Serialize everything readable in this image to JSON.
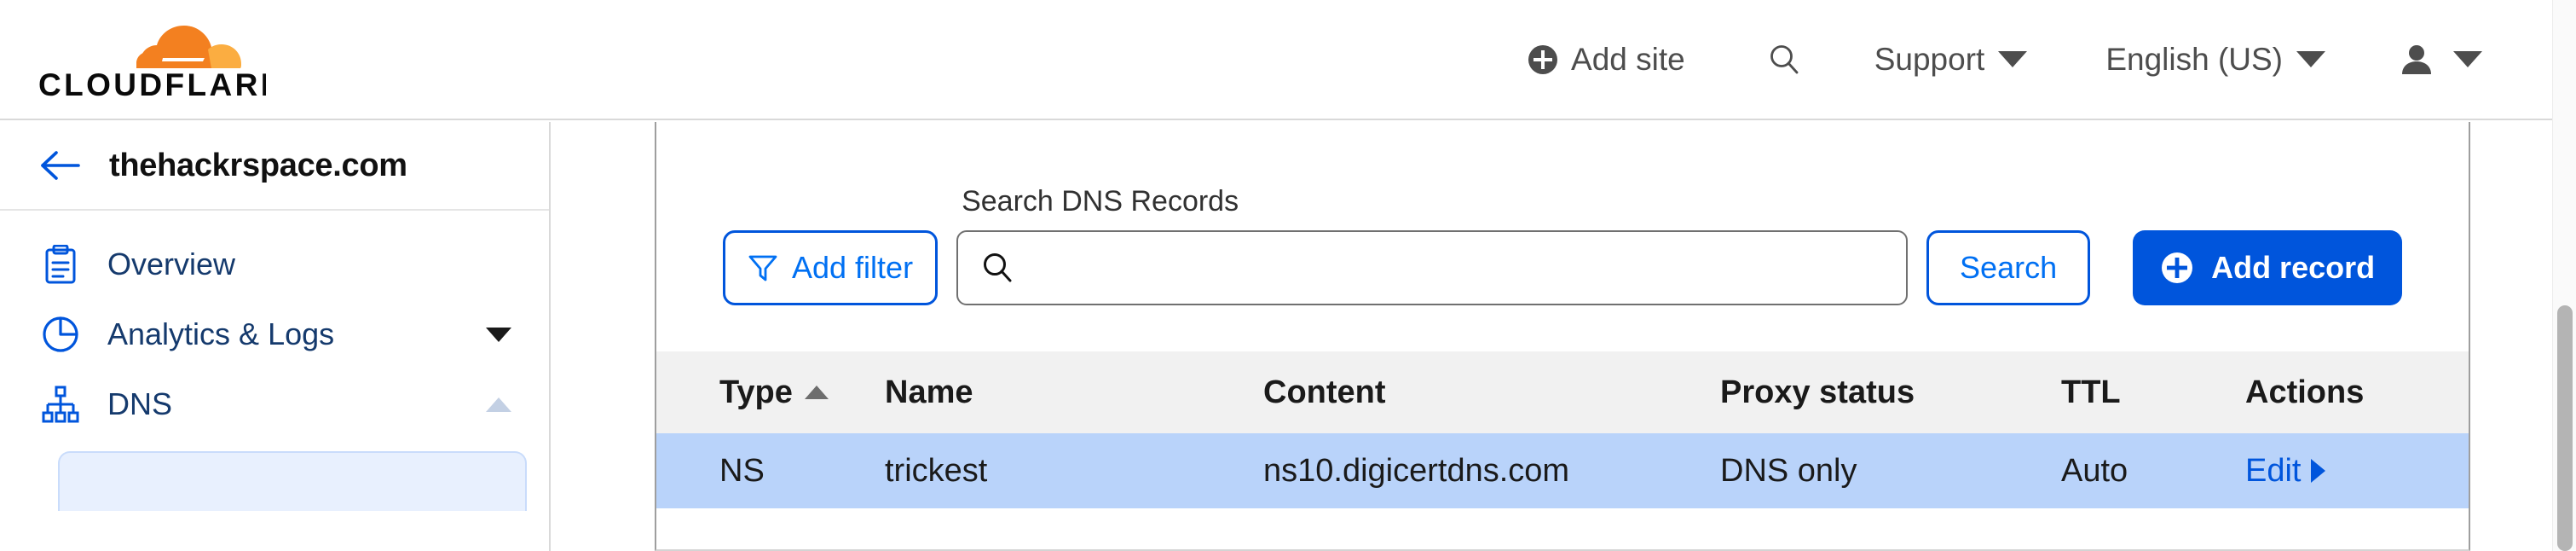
{
  "header": {
    "logo_name": "cloudflare-logo",
    "logo_wordmark": "CLOUDFLARE",
    "brand_orange": "#F38020",
    "brand_orange_light": "#FBAD41",
    "nav": {
      "add_site": "Add site",
      "search_icon": "search-icon",
      "support": "Support",
      "language": "English (US)",
      "user_icon": "person-icon"
    }
  },
  "sidebar": {
    "back_icon": "arrow-left-icon",
    "zone_name": "thehackrspace.com",
    "items": [
      {
        "label": "Overview",
        "icon": "clipboard-icon",
        "caret": "none"
      },
      {
        "label": "Analytics & Logs",
        "icon": "pie-chart-icon",
        "caret": "down"
      },
      {
        "label": "DNS",
        "icon": "sitemap-icon",
        "caret": "up"
      }
    ],
    "subitem_label": ""
  },
  "toolbar": {
    "add_filter_label": "Add filter",
    "filter_icon": "funnel-icon",
    "search_label": "Search DNS Records",
    "search_value": "",
    "search_placeholder": "",
    "search_icon": "magnifier-icon",
    "search_button_label": "Search",
    "add_record_label": "Add record",
    "add_record_icon": "plus-circle-icon"
  },
  "table": {
    "columns": [
      {
        "key": "type",
        "label": "Type",
        "sort": "asc"
      },
      {
        "key": "name",
        "label": "Name",
        "sort": "none"
      },
      {
        "key": "content",
        "label": "Content",
        "sort": "none"
      },
      {
        "key": "proxy",
        "label": "Proxy status",
        "sort": "none"
      },
      {
        "key": "ttl",
        "label": "TTL",
        "sort": "none"
      },
      {
        "key": "actions",
        "label": "Actions",
        "sort": "none"
      }
    ],
    "rows": [
      {
        "type": "NS",
        "name": "trickest",
        "content": "ns10.digicertdns.com",
        "proxy": "DNS only",
        "ttl": "Auto",
        "action_label": "Edit",
        "highlighted": true
      }
    ]
  },
  "colors": {
    "accent_blue": "#0055dc",
    "link_blue": "#0070f3",
    "row_highlight": "#b9d3fa",
    "table_header_bg": "#f1f1f1"
  }
}
